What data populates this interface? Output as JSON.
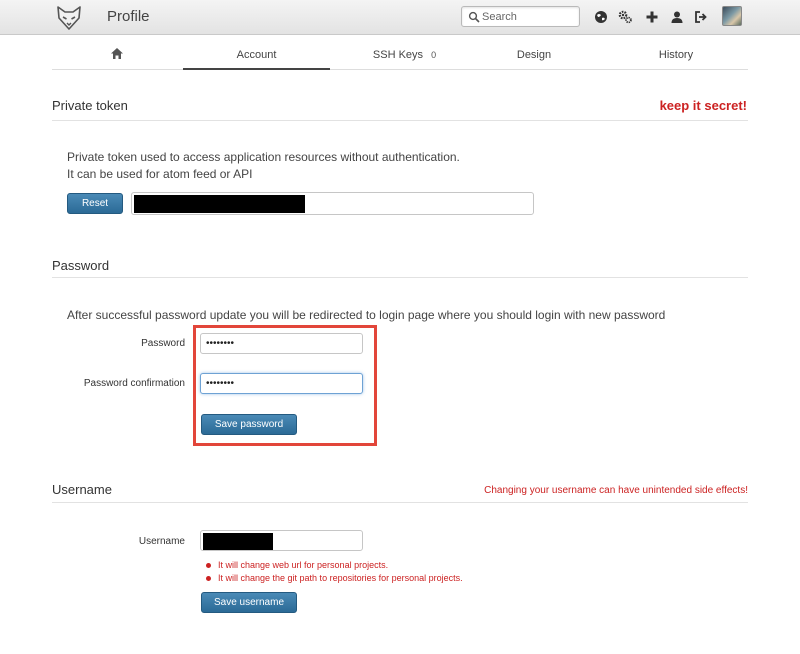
{
  "header": {
    "title": "Profile",
    "search_placeholder": "Search",
    "icons": [
      "fox-logo-icon",
      "search-icon",
      "globe-icon",
      "cogs-icon",
      "plus-icon",
      "user-icon",
      "sign-out-icon",
      "avatar"
    ]
  },
  "tabs": [
    {
      "label": "",
      "icon": "home-icon"
    },
    {
      "label": "Account",
      "active": true
    },
    {
      "label": "SSH Keys",
      "count": "0"
    },
    {
      "label": "Design"
    },
    {
      "label": "History"
    }
  ],
  "private_token": {
    "title": "Private token",
    "warning": "keep it secret!",
    "desc_line1": "Private token used to access application resources without authentication.",
    "desc_line2": "It can be used for atom feed or API",
    "reset_label": "Reset",
    "token_value": ""
  },
  "password": {
    "title": "Password",
    "description": "After successful password update you will be redirected to login page where you should login with new password",
    "password_label": "Password",
    "password_value": "••••••••",
    "confirmation_label": "Password confirmation",
    "confirmation_value": "••••••••",
    "save_label": "Save password"
  },
  "username": {
    "title": "Username",
    "warning": "Changing your username can have unintended side effects!",
    "label": "Username",
    "value": "",
    "notes": [
      "It will change web url for personal projects.",
      "It will change the git path to repositories for personal projects."
    ],
    "save_label": "Save username"
  },
  "colors": {
    "accent_button": "#2f6f9c",
    "warning_text": "#cc2222",
    "highlight_box": "#e2463a"
  }
}
